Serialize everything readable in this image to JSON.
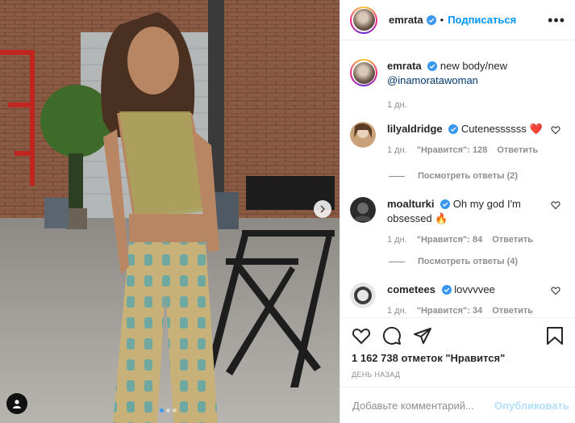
{
  "post": {
    "username": "emrata",
    "follow_label": "Подписаться",
    "more_label": "•••",
    "separator": "•"
  },
  "caption": {
    "username": "emrata",
    "text": "new body/new",
    "mention": "@inamoratawoman",
    "time": "1 дн."
  },
  "comments": [
    {
      "username": "lilyaldridge",
      "text": "Cutenessssss",
      "emoji": "❤️",
      "time": "1 дн.",
      "likes": "\"Нравится\": 128",
      "reply": "Ответить",
      "view_replies": "Посмотреть ответы (2)"
    },
    {
      "username": "moalturki",
      "text": "Oh my god I'm obsessed",
      "emoji": "🔥",
      "time": "1 дн.",
      "likes": "\"Нравится\": 84",
      "reply": "Ответить",
      "view_replies": "Посмотреть ответы (4)"
    },
    {
      "username": "cometees",
      "text": "lovvvvee",
      "time": "1 дн.",
      "likes": "\"Нравится\": 34",
      "reply": "Ответить"
    }
  ],
  "actions": {
    "likes_total": "1 162 738 отметок \"Нравится\"",
    "date": "ДЕНЬ НАЗАД"
  },
  "add_comment": {
    "placeholder": "Добавьте комментарий...",
    "publish_label": "Опубликовать"
  },
  "carousel": {
    "slides": 3,
    "active": 1
  },
  "colors": {
    "accent": "#0095f6",
    "publish_disabled": "#b2dffc",
    "verified": "#3897f0",
    "heart_red": "#ed4956"
  },
  "icons": [
    "heart-icon",
    "comment-icon",
    "share-icon",
    "bookmark-icon",
    "chevron-right-icon",
    "user-tag-icon",
    "verified-badge-icon"
  ]
}
